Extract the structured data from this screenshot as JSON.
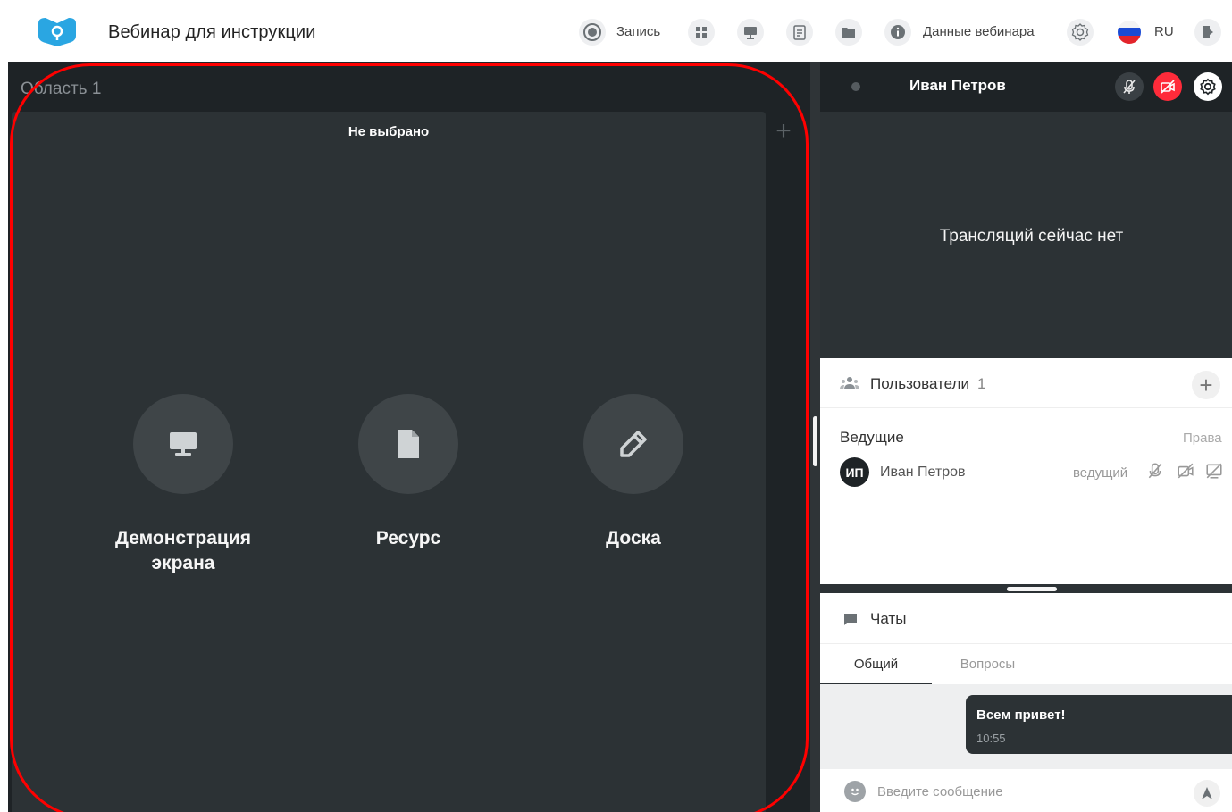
{
  "app": {
    "title": "Вебинар для инструкции"
  },
  "toolbar": {
    "record_label": "Запись",
    "webinar_data_label": "Данные вебинара",
    "language_label": "RU",
    "icons": [
      "record-icon",
      "layout-icon",
      "screen-icon",
      "notes-icon",
      "folder-icon",
      "info-icon",
      "settings-icon",
      "flag-ru-icon",
      "exit-icon"
    ]
  },
  "stage": {
    "area_title": "Область 1",
    "tab_title": "Не выбрано",
    "add_tab_glyph": "+",
    "sources": [
      {
        "label_line1": "Демонстрация",
        "label_line2": "экрана",
        "icon": "monitor-icon"
      },
      {
        "label_line1": "Ресурс",
        "label_line2": "",
        "icon": "file-icon"
      },
      {
        "label_line1": "Доска",
        "label_line2": "",
        "icon": "pencil-icon"
      }
    ]
  },
  "video": {
    "speaker_name": "Иван Петров",
    "empty_text": "Трансляций сейчас нет"
  },
  "users": {
    "title": "Пользователи",
    "count": "1",
    "add_glyph": "+",
    "group_title": "Ведущие",
    "rights_label": "Права",
    "members": [
      {
        "initials": "ИП",
        "name": "Иван Петров",
        "role": "ведущий"
      }
    ]
  },
  "chats": {
    "title": "Чаты",
    "tabs": [
      "Общий",
      "Вопросы"
    ],
    "messages": [
      {
        "text": "Всем привет!",
        "time": "10:55"
      }
    ],
    "input_placeholder": "Введите сообщение"
  },
  "colors": {
    "accent_blue": "#29a3e0",
    "dark_bg": "#1e2326",
    "panel_bg": "#2c3235",
    "alert_red": "#ff2b3a",
    "outline_red": "#ff0000"
  }
}
